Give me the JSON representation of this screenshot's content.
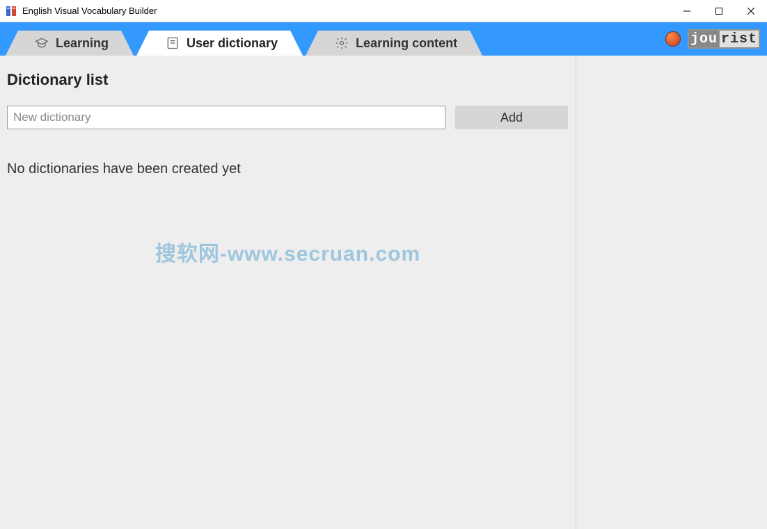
{
  "window": {
    "title": "English Visual Vocabulary Builder"
  },
  "tabs": {
    "learning": "Learning",
    "user_dictionary": "User dictionary",
    "learning_content": "Learning content",
    "active": "user_dictionary"
  },
  "branding": {
    "logo_text_1": "jou",
    "logo_text_2": "rist"
  },
  "main": {
    "heading": "Dictionary list",
    "input_placeholder": "New dictionary",
    "input_value": "",
    "add_label": "Add",
    "empty_message": "No dictionaries have been created yet"
  },
  "watermark": "搜软网-www.secruan.com"
}
